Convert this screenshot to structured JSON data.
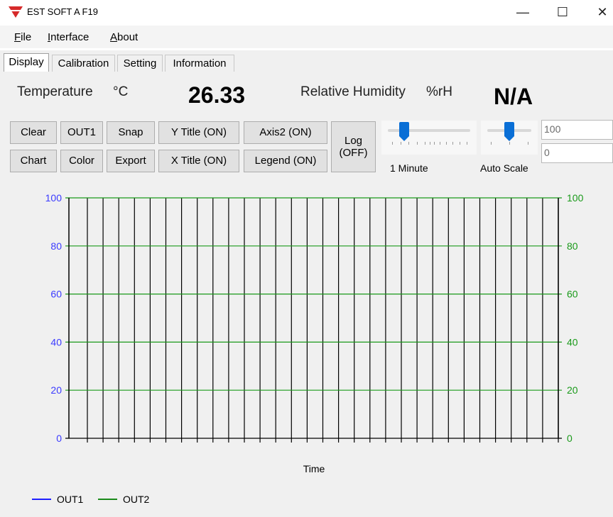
{
  "window": {
    "title": "EST SOFT A F19",
    "logo_color": "#d62a2a",
    "controls": {
      "minimize": "—",
      "maximize": "☐",
      "close": "✕"
    }
  },
  "menu": {
    "items": [
      {
        "label_first": "F",
        "label_rest": "ile"
      },
      {
        "label_first": "I",
        "label_rest": "nterface"
      },
      {
        "label_first": "A",
        "label_rest": "bout"
      }
    ]
  },
  "tabs": [
    "Display",
    "Calibration",
    "Setting",
    "Information"
  ],
  "active_tab": "Display",
  "readout": {
    "temperature_label": "Temperature",
    "temperature_unit": "°C",
    "temperature_value": "26.33",
    "humidity_label": "Relative Humidity",
    "humidity_unit": "%rH",
    "humidity_value": "N/A"
  },
  "buttons": {
    "clear": "Clear",
    "out1": "OUT1",
    "snap": "Snap",
    "y_title": "Y Title (ON)",
    "axis2": "Axis2 (ON)",
    "chart": "Chart",
    "color": "Color",
    "export": "Export",
    "x_title": "X Title (ON)",
    "legend": "Legend (ON)",
    "log_line1": "Log",
    "log_line2": "(OFF)"
  },
  "time_slider": {
    "label": "1 Minute",
    "level": 0.2
  },
  "scale_slider": {
    "label": "Auto Scale",
    "level": 0.5
  },
  "scale_inputs": {
    "max": "100",
    "min": "0"
  },
  "chart_data": {
    "type": "line",
    "xlabel": "Time",
    "ylim": [
      0,
      100
    ],
    "y_ticks": [
      "0",
      "20",
      "40",
      "60",
      "80",
      "100"
    ],
    "y2_ticks": [
      "0",
      "20",
      "40",
      "60",
      "80",
      "100"
    ],
    "y_tick_color": "#3b3bff",
    "y2_tick_color": "#1a9a1a",
    "grid": true,
    "vertical_gridlines": 30,
    "series": [
      {
        "name": "OUT1",
        "color": "#1f1fff",
        "values": []
      },
      {
        "name": "OUT2",
        "color": "#1a8a1a",
        "values": []
      }
    ],
    "legend_position": "bottom-left"
  }
}
